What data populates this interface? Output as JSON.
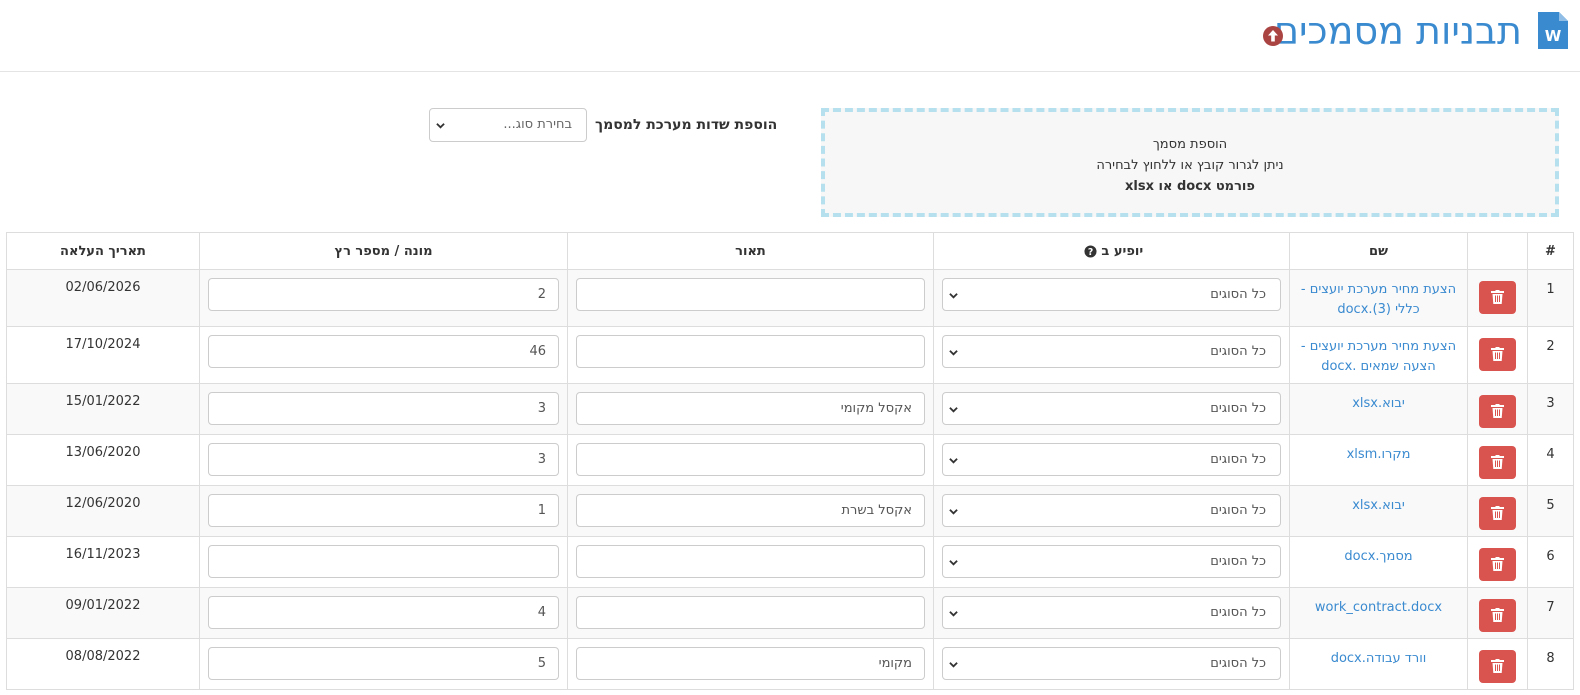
{
  "header": {
    "title": "תבניות מסמכים",
    "icon": "word-document-icon",
    "upload_icon": "arrow-up-circle-icon",
    "title_color": "#3a8ad0"
  },
  "dropzone": {
    "line1": "הוספת מסמך",
    "line2": "ניתן לגרור קובץ או ללחוץ לבחירה",
    "line3": "פורמט docx או xlsx"
  },
  "system_fields": {
    "label": "הוספת שדות מערכת למסמך",
    "placeholder": "בחירת סוג..."
  },
  "table": {
    "columns": {
      "num": "#",
      "name": "שם",
      "appears_in": "יופיע ב",
      "description": "תאור",
      "counter": "מונה / מספר רץ",
      "upload_date": "תאריך העלאה"
    },
    "rows": [
      {
        "num": "1",
        "name": "הצעת מחיר מערכת יועצים - כללי (3).docx",
        "appears_in": "כל הסוגים",
        "description": "",
        "counter": "2",
        "date": "02/06/2026"
      },
      {
        "num": "2",
        "name": "הצעת מחיר מערכת יועצים - הצעה שמאים .docx",
        "appears_in": "כל הסוגים",
        "description": "",
        "counter": "46",
        "date": "17/10/2024"
      },
      {
        "num": "3",
        "name": "יבוא.xlsx",
        "appears_in": "כל הסוגים",
        "description": "אקסל מקומי",
        "counter": "3",
        "date": "15/01/2022"
      },
      {
        "num": "4",
        "name": "מקרו.xlsm",
        "appears_in": "כל הסוגים",
        "description": "",
        "counter": "3",
        "date": "13/06/2020"
      },
      {
        "num": "5",
        "name": "יבוא.xlsx",
        "appears_in": "כל הסוגים",
        "description": "אקסל בשרת",
        "counter": "1",
        "date": "12/06/2020"
      },
      {
        "num": "6",
        "name": "מסמך.docx",
        "appears_in": "כל הסוגים",
        "description": "",
        "counter": "",
        "date": "16/11/2023"
      },
      {
        "num": "7",
        "name": "work_contract.docx",
        "appears_in": "כל הסוגים",
        "description": "",
        "counter": "4",
        "date": "09/01/2022"
      },
      {
        "num": "8",
        "name": "וורד עבודה.docx",
        "appears_in": "כל הסוגים",
        "description": "מקומי",
        "counter": "5",
        "date": "08/08/2022"
      }
    ]
  },
  "colors": {
    "delete_button": "#d9534f",
    "link": "#3a8ad0",
    "dropzone_border": "#b6e0ee"
  }
}
